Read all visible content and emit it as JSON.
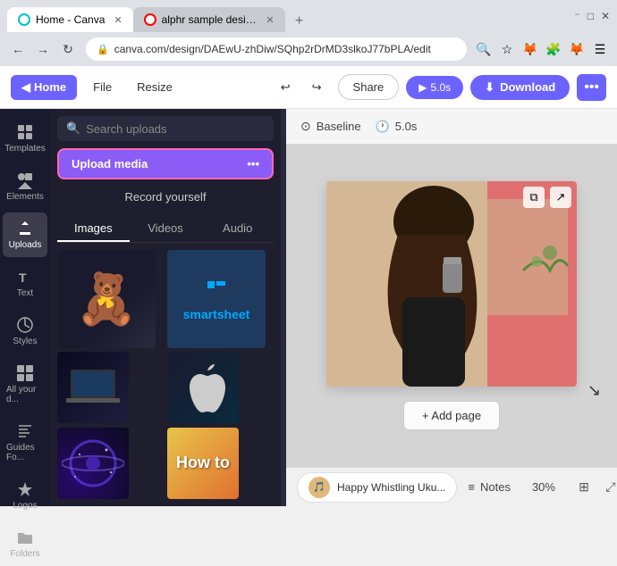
{
  "browser": {
    "tabs": [
      {
        "id": "canva",
        "label": "Home - Canva",
        "active": true,
        "favicon": "canva"
      },
      {
        "id": "youtube",
        "label": "alphr sample design - YouTube",
        "active": false,
        "favicon": "youtube"
      }
    ],
    "address": "canva.com/design/DAEwU-zhDiw/SQhp2rDrMD3slkoJ77bPLA/edit",
    "add_tab_label": "+"
  },
  "app_bar": {
    "home_label": "Home",
    "menu_items": [
      "File",
      "Resize"
    ],
    "share_label": "Share",
    "play_label": "5.0s",
    "download_label": "Download",
    "more_label": "..."
  },
  "sidebar": {
    "items": [
      {
        "id": "templates",
        "label": "Templates",
        "icon": "grid"
      },
      {
        "id": "elements",
        "label": "Elements",
        "icon": "shapes"
      },
      {
        "id": "uploads",
        "label": "Uploads",
        "icon": "upload",
        "active": true
      },
      {
        "id": "text",
        "label": "Text",
        "icon": "text"
      },
      {
        "id": "styles",
        "label": "Styles",
        "icon": "palette"
      },
      {
        "id": "all",
        "label": "All your d...",
        "icon": "apps"
      },
      {
        "id": "guides",
        "label": "Guides Fo...",
        "icon": "bookmark"
      },
      {
        "id": "logos",
        "label": "Logos",
        "icon": "star"
      },
      {
        "id": "folders",
        "label": "Folders",
        "icon": "folder"
      }
    ]
  },
  "uploads_panel": {
    "search_placeholder": "Search uploads",
    "upload_media_label": "Upload media",
    "record_label": "Record yourself",
    "tabs": [
      {
        "id": "images",
        "label": "Images",
        "active": true
      },
      {
        "id": "videos",
        "label": "Videos",
        "active": false
      },
      {
        "id": "audio",
        "label": "Audio",
        "active": false
      }
    ],
    "more_icon_label": "..."
  },
  "canvas": {
    "baseline_label": "Baseline",
    "duration_label": "5.0s",
    "add_page_label": "+ Add page"
  },
  "bottom_bar": {
    "audio_label": "Happy Whistling Uku...",
    "notes_label": "Notes",
    "zoom_label": "30%"
  },
  "colors": {
    "sidebar_bg": "#1a1a2e",
    "panel_bg": "#1e1e2e",
    "accent": "#8b5cf6",
    "accent2": "#6c63ff",
    "pink_border": "#ff69b4"
  }
}
